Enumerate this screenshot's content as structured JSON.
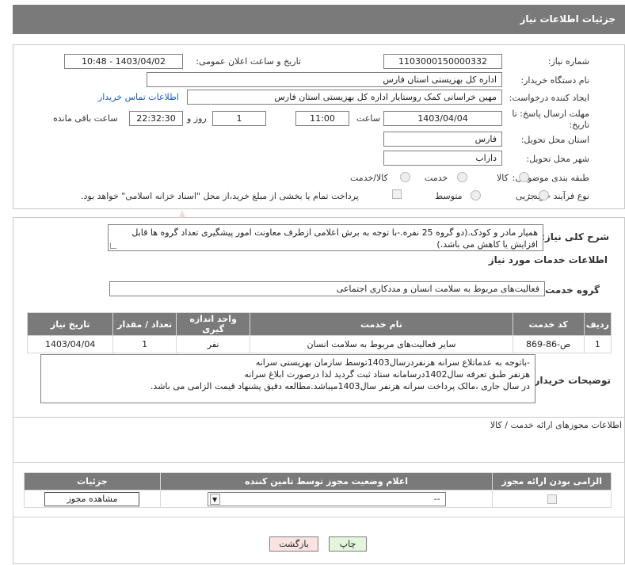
{
  "header": {
    "title": "جزئیات اطلاعات نیاز"
  },
  "form": {
    "need_number_label": "شماره نیاز:",
    "need_number": "1103000150000332",
    "announce_label": "تاریخ و ساعت اعلان عمومی:",
    "announce_value": "1403/04/02 - 10:48",
    "buyer_label": "نام دستگاه خریدار:",
    "buyer_value": "اداره کل بهزیستی استان فارس",
    "creator_label": "ایجاد کننده درخواست:",
    "creator_value": "مهین خراسانی کمک روستایار اداره کل بهزیستی استان فارس",
    "contact_link": "اطلاعات تماس خریدار",
    "deadline_label_1": "مهلت ارسال پاسخ: تا",
    "deadline_label_2": "تاریخ:",
    "deadline_date": "1403/04/04",
    "time_label": "ساعت",
    "deadline_time": "11:00",
    "days_value": "1",
    "days_label": "روز و",
    "remaining_time": "22:32:30",
    "remaining_label": "ساعت باقی مانده",
    "province_label": "استان محل تحویل:",
    "province_value": "فارس",
    "city_label": "شهر محل تحویل:",
    "city_value": "داراب",
    "category_label": "طبقه بندی موضوعی:",
    "category_options": [
      "کالا",
      "خدمت",
      "کالا/خدمت"
    ],
    "purchase_label": "نوع فرآیند خرید :",
    "purchase_options": [
      "جزیی",
      "متوسط"
    ],
    "treasury_text": "پرداخت تمام یا بخشی از مبلغ خرید،از محل \"اسناد خزانه اسلامی\" خواهد بود."
  },
  "summary": {
    "label": "شرح کلی نیاز:",
    "text": "همیار مادر و کودک.(دو گروه 25 نفره.-با توجه به برش اعلامی ازطرف معاونت امور پیشگیری تعداد گروه ها قابل افزایش یا کاهش می باشد.)"
  },
  "services": {
    "section_title": "اطلاعات خدمات مورد نیاز",
    "group_label": "گروه خدمت:",
    "group_value": "فعالیت‌های مربوط به سلامت انسان و مددکاری اجتماعی",
    "table": {
      "headers": [
        "ردیف",
        "کد خدمت",
        "نام خدمت",
        "واحد اندازه گیری",
        "تعداد / مقدار",
        "تاریخ نیاز"
      ],
      "rows": [
        [
          "1",
          "ص-86-869",
          "سایر فعالیت‌های مربوط به سلامت انسان",
          "نفر",
          "1",
          "1403/04/04"
        ]
      ]
    }
  },
  "buyer_notes": {
    "label": "توضیحات خریدار:",
    "lines": [
      "-باتوجه به عدماتلاع سرانه هزنفردرسال1403توسط سازمان بهزیستی سرانه",
      "هزنفر طبق تعرفه سال1402درسامانه ستاد ثبت گردید لذا درصورت ابلاغ سرانه",
      "در سال جاری ،مالک پرداخت سرانه هزنفر سال1403میباشد.مطالعه دقیق پشنهاد قیمت الزامی می باشد."
    ]
  },
  "permits": {
    "section_title": "اطلاعات مجوزهای ارائه خدمت / کالا",
    "headers": [
      "الزامی بودن ارائه مجوز",
      "اعلام وضعیت مجوز توسط تامین کننده",
      "جزئیات"
    ],
    "select_value": "--",
    "view_button": "مشاهده مجوز"
  },
  "footer": {
    "print_button": "چاپ",
    "back_button": "بازگشت"
  },
  "watermark": {
    "text": "AriaTender.neT"
  },
  "colors": {
    "header_bg": "#7a7a7a",
    "link": "#1a56c8",
    "print_bg": "#e3f5dc",
    "back_bg": "#fbe3e3"
  }
}
